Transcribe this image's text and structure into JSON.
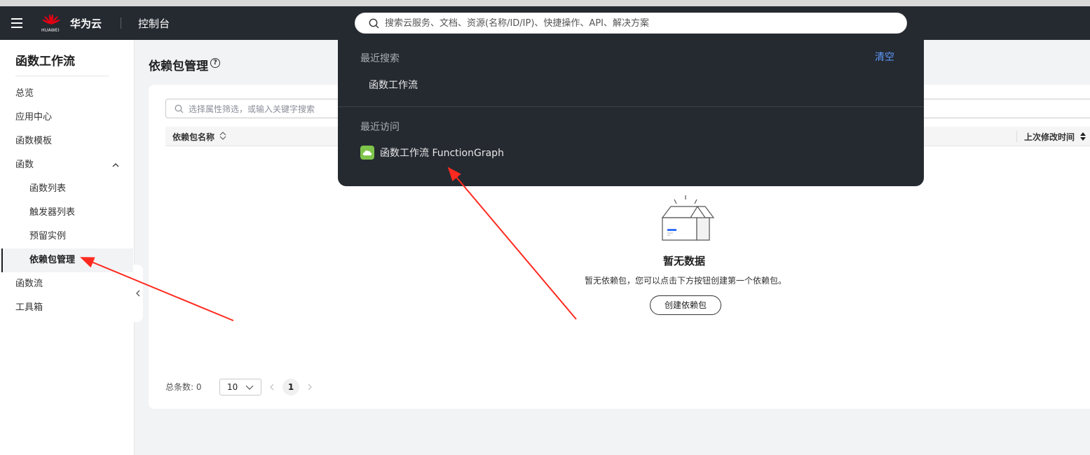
{
  "header": {
    "brand": "华为云",
    "logo_text": "HUAWEI",
    "console": "控制台"
  },
  "search": {
    "placeholder": "搜索云服务、文档、资源(名称/ID/IP)、快捷操作、API、解决方案",
    "recent_label": "最近搜索",
    "clear_label": "清空",
    "recent_items": [
      "函数工作流"
    ],
    "visit_label": "最近访问",
    "visit_items": [
      "函数工作流 FunctionGraph"
    ]
  },
  "sidebar": {
    "title": "函数工作流",
    "items": [
      "总览",
      "应用中心",
      "函数模板",
      "函数",
      "函数列表",
      "触发器列表",
      "预留实例",
      "依赖包管理",
      "函数流",
      "工具箱"
    ]
  },
  "main": {
    "title": "依赖包管理",
    "filter_placeholder": "选择属性筛选，或输入关键字搜索",
    "columns": [
      "依赖包名称",
      "上次修改时间"
    ],
    "empty_title": "暂无数据",
    "empty_desc": "暂无依赖包，您可以点击下方按钮创建第一个依赖包。",
    "create_button": "创建依赖包",
    "total_label": "总条数: 0",
    "page_size": "10",
    "current_page": "1"
  },
  "colors": {
    "header_bg": "#252a31",
    "accent_link": "#5e9bff",
    "service_icon": "#7ec44a",
    "annotation_arrow": "#ff2a1f"
  }
}
